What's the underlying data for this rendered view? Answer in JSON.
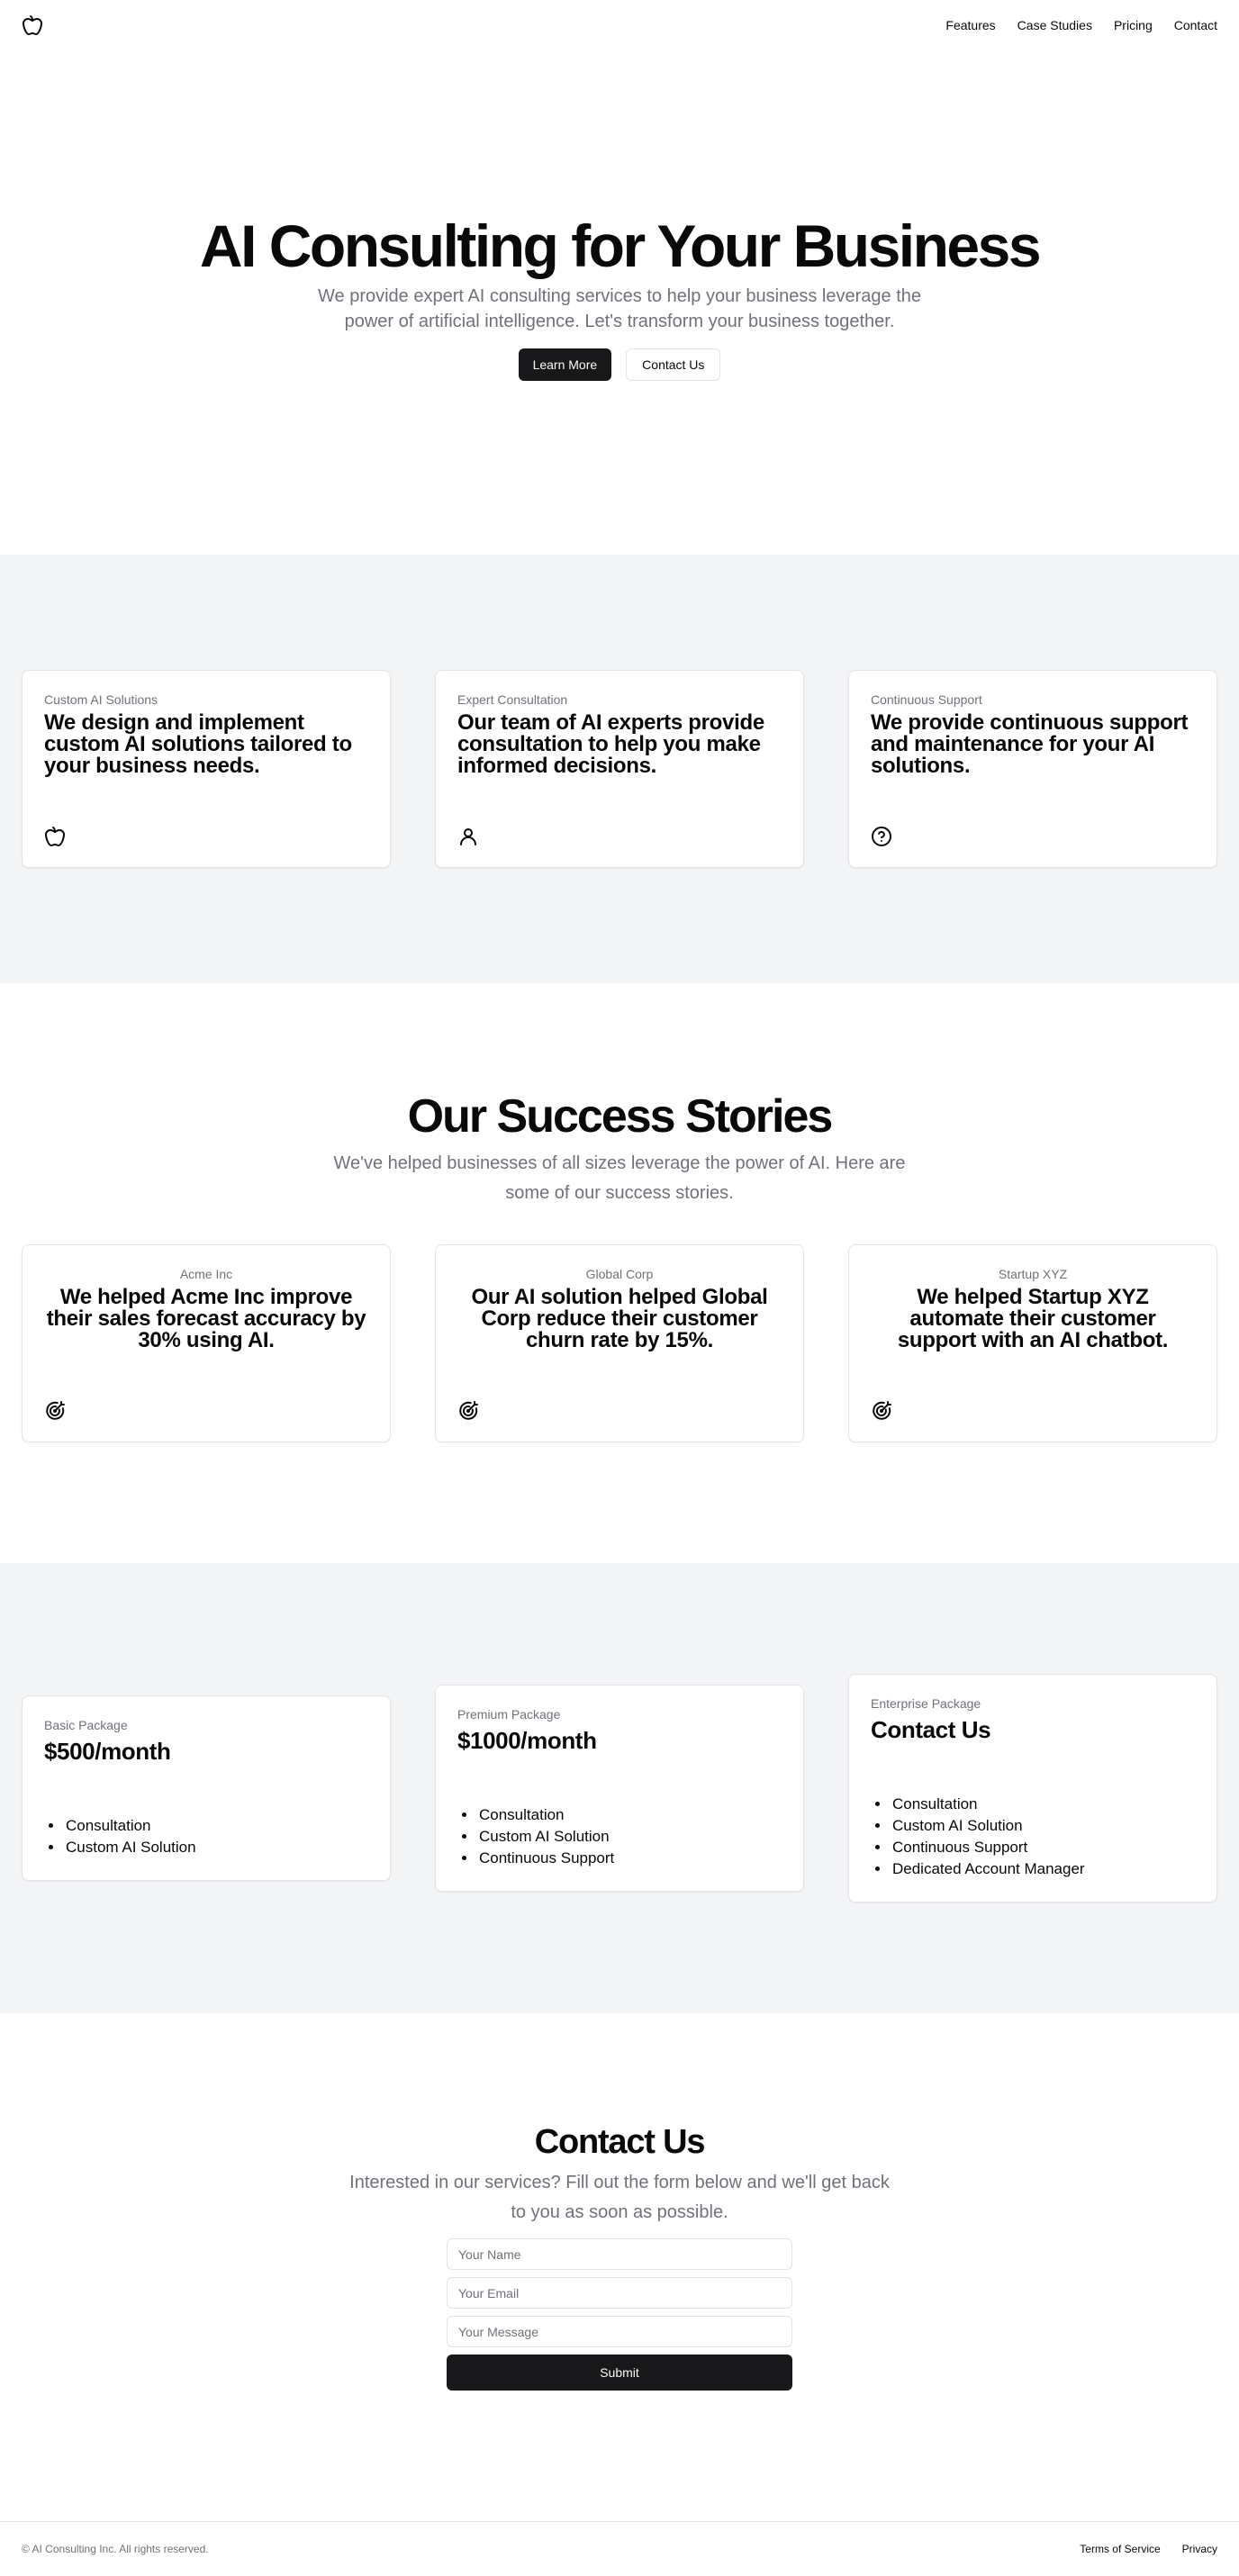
{
  "header": {
    "logo_icon": "apple-icon",
    "nav": [
      "Features",
      "Case Studies",
      "Pricing",
      "Contact"
    ]
  },
  "hero": {
    "title": "AI Consulting for Your Business",
    "subtitle": "We provide expert AI consulting services to help your business leverage the power of artificial intelligence. Let's transform your business together.",
    "primary_button": "Learn More",
    "secondary_button": "Contact Us"
  },
  "features": [
    {
      "label": "Custom AI Solutions",
      "text": "We design and implement custom AI solutions tailored to your business needs.",
      "icon": "apple-icon"
    },
    {
      "label": "Expert Consultation",
      "text": "Our team of AI experts provide consultation to help you make informed decisions.",
      "icon": "user-icon"
    },
    {
      "label": "Continuous Support",
      "text": "We provide continuous support and maintenance for your AI solutions.",
      "icon": "help-circle-icon"
    }
  ],
  "stories": {
    "title": "Our Success Stories",
    "subtitle": "We've helped businesses of all sizes leverage the power of AI. Here are some of our success stories.",
    "items": [
      {
        "company": "Acme Inc",
        "text": "We helped Acme Inc improve their sales forecast accuracy by 30% using AI.",
        "icon": "target-icon"
      },
      {
        "company": "Global Corp",
        "text": "Our AI solution helped Global Corp reduce their customer churn rate by 15%.",
        "icon": "target-icon"
      },
      {
        "company": "Startup XYZ",
        "text": "We helped Startup XYZ automate their customer support with an AI chatbot.",
        "icon": "target-icon"
      }
    ]
  },
  "pricing": [
    {
      "package": "Basic Package",
      "price": "$500/month",
      "features": [
        "Consultation",
        "Custom AI Solution"
      ]
    },
    {
      "package": "Premium Package",
      "price": "$1000/month",
      "features": [
        "Consultation",
        "Custom AI Solution",
        "Continuous Support"
      ]
    },
    {
      "package": "Enterprise Package",
      "price": "Contact Us",
      "features": [
        "Consultation",
        "Custom AI Solution",
        "Continuous Support",
        "Dedicated Account Manager"
      ]
    }
  ],
  "contact": {
    "title": "Contact Us",
    "subtitle": "Interested in our services? Fill out the form below and we'll get back to you as soon as possible.",
    "name_placeholder": "Your Name",
    "email_placeholder": "Your Email",
    "message_placeholder": "Your Message",
    "submit": "Submit"
  },
  "footer": {
    "copyright": "© AI Consulting Inc. All rights reserved.",
    "links": [
      "Terms of Service",
      "Privacy"
    ]
  }
}
